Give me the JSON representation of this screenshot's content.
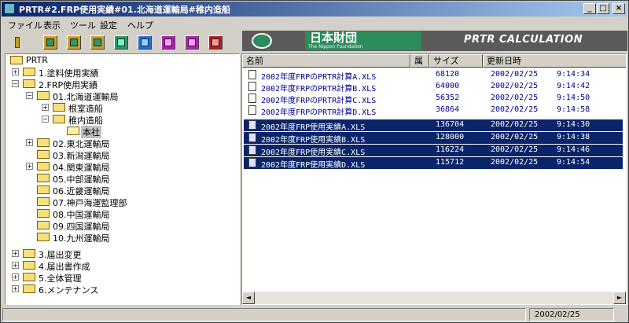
{
  "window": {
    "title": "PRTR#2.FRP使用実績#01.北海道運輸局#稚内造船"
  },
  "caption_buttons": [
    "_",
    "□",
    "×"
  ],
  "menu": [
    "ファイル",
    "表示",
    "ツール",
    "設定",
    "ヘルプ"
  ],
  "banner": {
    "logo_text": "日本財団",
    "logo_subtext": "The Nippon Foundation",
    "calc_text": "PRTR CALCULATION"
  },
  "tree": [
    {
      "label": "PRTR"
    },
    {
      "label": "1.塗料使用実績"
    },
    {
      "label": "2.FRP使用実績"
    },
    {
      "label": "01.北海道運輸局"
    },
    {
      "label": "根室造船"
    },
    {
      "label": "稚内造船"
    },
    {
      "label": "本社"
    },
    {
      "label": "02.東北運輸局"
    },
    {
      "label": "03.新潟運輸局"
    },
    {
      "label": "04.関東運輸局"
    },
    {
      "label": "05.中部運輸局"
    },
    {
      "label": "06.近畿運輸局"
    },
    {
      "label": "07.神戸海運監理部"
    },
    {
      "label": "08.中国運輸局"
    },
    {
      "label": "09.四国運輸局"
    },
    {
      "label": "10.九州運輸局"
    },
    {
      "label": "3.届出変更"
    },
    {
      "label": "4.届出書作成"
    },
    {
      "label": "5.全体管理"
    },
    {
      "label": "6.メンテナンス"
    }
  ],
  "list": {
    "columns": [
      "名前",
      "属",
      "サイズ",
      "更新日時"
    ],
    "rows": [
      {
        "name": "2002年度FRPのPRTR計算A.XLS",
        "size": "68120",
        "date": "2002/02/25",
        "time": "9:14:34"
      },
      {
        "name": "2002年度FRPのPRTR計算B.XLS",
        "size": "64000",
        "date": "2002/02/25",
        "time": "9:14:42"
      },
      {
        "name": "2002年度FRPのPRTR計算C.XLS",
        "size": "56352",
        "date": "2002/02/25",
        "time": "9:14:50"
      },
      {
        "name": "2002年度FRPのPRTR計算D.XLS",
        "size": "36864",
        "date": "2002/02/25",
        "time": "9:14:58"
      },
      {
        "name": "2002年度FRP使用実績A.XLS",
        "size": "136704",
        "date": "2002/02/25",
        "time": "9:14:30"
      },
      {
        "name": "2002年度FRP使用実績B.XLS",
        "size": "128000",
        "date": "2002/02/25",
        "time": "9:14:38"
      },
      {
        "name": "2002年度FRP使用実績C.XLS",
        "size": "116224",
        "date": "2002/02/25",
        "time": "9:14:46"
      },
      {
        "name": "2002年度FRP使用実績D.XLS",
        "size": "115712",
        "date": "2002/02/25",
        "time": "9:14:54"
      }
    ]
  },
  "scroll_arrows": [
    "◄",
    "►"
  ],
  "status": {
    "date": "2002/02/25"
  }
}
